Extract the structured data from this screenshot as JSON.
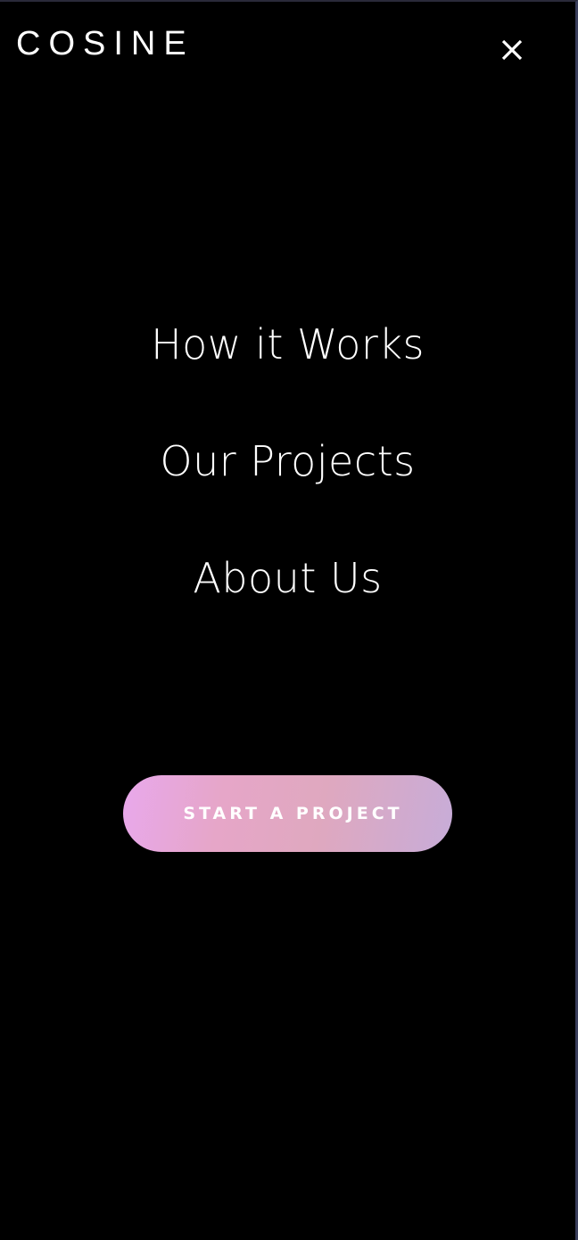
{
  "header": {
    "logo_text": "COSINE",
    "close_icon": "close-icon"
  },
  "nav": {
    "items": [
      {
        "label": "How it Works"
      },
      {
        "label": "Our Projects"
      },
      {
        "label": "About Us"
      }
    ]
  },
  "cta": {
    "label": "START A PROJECT"
  },
  "colors": {
    "background": "#000000",
    "text": "#ffffff",
    "cta_gradient_start": "#e8a8ec",
    "cta_gradient_end": "#c7acd8"
  }
}
